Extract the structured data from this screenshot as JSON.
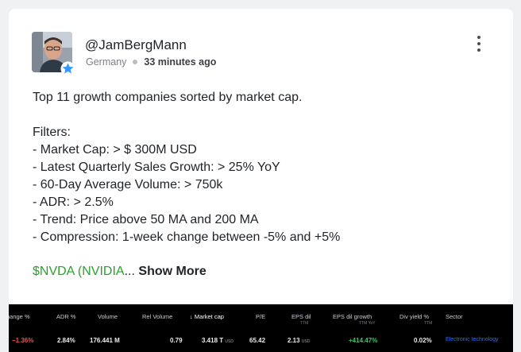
{
  "post": {
    "username": "@JamBergMann",
    "location": "Germany",
    "time": "33 minutes ago",
    "text": "Top 11 growth companies sorted by market cap.\n\nFilters:\n- Market Cap: > $ 300M USD\n- Latest Quarterly Sales Growth: > 25% YoY\n- 60-Day Average Volume: > 750k\n- ADR: > 2.5%\n- Trend: Price above 50 MA and 200 MA\n- Compression: 1-week change between -5% and +5%",
    "ticker": "$NVDA (NVIDIA",
    "ellipsis": "...",
    "show_more": "Show More"
  },
  "colors": {
    "ticker": "#29a329",
    "negative": "#f0524d",
    "positive": "#3cc36a",
    "sector_link": "#2e6fe8",
    "table_bg": "#000000"
  },
  "icons": {
    "verified_badge": "star-badge-icon",
    "more": "more-vertical-icon",
    "sort": "arrow-down-icon"
  },
  "table": {
    "headers": {
      "change_pct": "hange %",
      "adr_pct": "ADR %",
      "volume": "Volume",
      "rel_volume": "Rel Volume",
      "market_cap": "Market cap",
      "pe": "P/E",
      "eps_dil": "EPS dil",
      "eps_dil_sub": "TTM",
      "eps_growth": "EPS dil growth",
      "eps_growth_sub": "TTM YoY",
      "div_yield": "Div yield %",
      "div_yield_sub": "TTM",
      "sector": "Sector"
    },
    "row": {
      "change_pct": "−1.36%",
      "adr_pct": "2.84%",
      "volume": "176.441 M",
      "rel_volume": "0.79",
      "market_cap": "3.418 T",
      "market_cap_unit": "USD",
      "pe": "65.42",
      "eps_dil": "2.13",
      "eps_dil_unit": "USD",
      "eps_growth": "+414.47%",
      "div_yield": "0.02%",
      "sector": "Electronic technology"
    }
  }
}
